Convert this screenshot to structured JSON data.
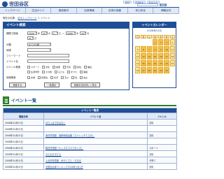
{
  "header": {
    "site_name": "世田谷区",
    "links": [
      "携帯",
      "文字拡大",
      "読み上げ"
    ],
    "search_button": "検索"
  },
  "nav": [
    "トップページ",
    "生活ガイド",
    "施設案内",
    "区政情報",
    "区長の部屋",
    "安心安全",
    "情報目次"
  ],
  "breadcrumb": {
    "prefix": "現在の位置：",
    "home": "区のトップページ",
    "sep": "＞",
    "current": "イベント"
  },
  "search_panel": {
    "title": "イベント検索",
    "period_label": "期間で検索",
    "from": {
      "year": "2008",
      "year_unit": "年",
      "month": "10",
      "month_unit": "月",
      "day": "1",
      "day_unit": "日",
      "tilde": "～"
    },
    "to": {
      "year": "2008",
      "year_unit": "年",
      "month": "10",
      "month_unit": "月",
      "day": "31",
      "day_unit": "日"
    },
    "category_label": "分類",
    "category_value": "全ての分類",
    "area_label": "地域",
    "free_word_label": "フリーワード",
    "event_name_label": "イベント名",
    "genre_label": "ジャンル検索",
    "genres_row1": [
      "スポーツ",
      "文化",
      "健康",
      "育児",
      "環境",
      "福祉"
    ],
    "genres_row2": [
      "生涯学習",
      "その他",
      "子ども",
      "まつり",
      "講座"
    ],
    "area_search_label": "地域検索",
    "areas": [
      "全域",
      "世田谷",
      "北沢",
      "玉川",
      "砧",
      "烏山"
    ],
    "buttons": {
      "search": "検索する",
      "all": "一覧表示",
      "help": "検索方法を詳しく見る"
    }
  },
  "calendar": {
    "title": "イベントカレンダー",
    "month_label": "2008年10月",
    "weekdays": [
      "日",
      "月",
      "火",
      "水",
      "木",
      "金",
      "土"
    ],
    "days": [
      "",
      "",
      "",
      "1",
      "2",
      "3",
      "4",
      "5",
      "6",
      "7",
      "8",
      "9",
      "10",
      "11",
      "12",
      "13",
      "14",
      "15",
      "16",
      "17",
      "18",
      "19",
      "20",
      "21",
      "22",
      "23",
      "24",
      "25",
      "26",
      "27",
      "28",
      "29",
      "30",
      "31",
      ""
    ]
  },
  "results": {
    "section_title": "イベント一覧",
    "table_caption": "イベント一覧表",
    "headers": [
      "開催日時",
      "イベント名",
      "ジャンル"
    ],
    "rows": [
      {
        "date": "2008年10月01日",
        "name": "ほらっぱでおはなし",
        "genre": "文化"
      },
      {
        "date": "2008年10月01日",
        "name": "",
        "genre": ""
      },
      {
        "date": "2008年10月01日",
        "name": "深沢児童館　講師地域活動『ストレッチとヨガ』",
        "genre": "文化"
      },
      {
        "date": "2008年10月01日",
        "name": "",
        "genre": ""
      },
      {
        "date": "2008年10月01日",
        "name": "駒沢児童館『キッズスクエアポンズ』",
        "genre": "スポーツ"
      },
      {
        "date": "2008年10月01日",
        "name": "おでかけ子ども",
        "genre": "文化"
      },
      {
        "date": "2008年10月01日",
        "name": "上北沢児童館　めやくさと・ちるる",
        "genre": "子育て"
      },
      {
        "date": "2008年10月01日",
        "name": "全国自治体ランキング2008年1月1日",
        "genre": "文化"
      }
    ]
  }
}
